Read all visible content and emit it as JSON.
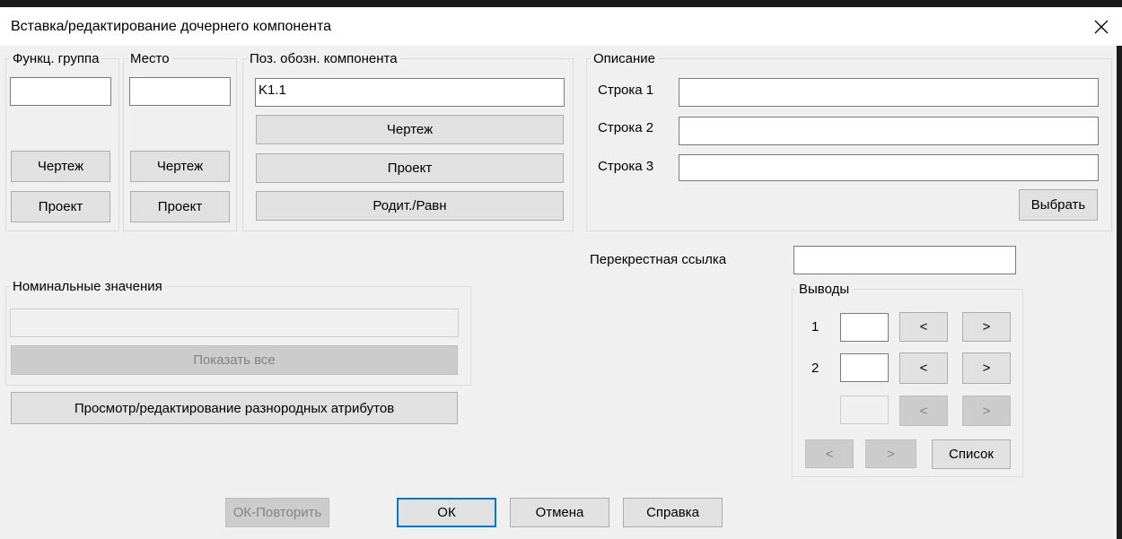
{
  "window": {
    "title": "Вставка/редактирование дочернего компонента"
  },
  "func_group": {
    "legend": "Функц. группа",
    "value": "",
    "drawing_button": "Чертеж",
    "project_button": "Проект"
  },
  "place": {
    "legend": "Место",
    "value": "",
    "drawing_button": "Чертеж",
    "project_button": "Проект"
  },
  "component": {
    "legend": "Поз. обозн. компонента",
    "value": "K1.1",
    "drawing_button": "Чертеж",
    "project_button": "Проект",
    "parent_button": "Родит./Равн"
  },
  "description": {
    "legend": "Описание",
    "lines": [
      {
        "label": "Строка 1",
        "value": ""
      },
      {
        "label": "Строка 2",
        "value": ""
      },
      {
        "label": "Строка 3",
        "value": ""
      }
    ],
    "select_button": "Выбрать"
  },
  "nominal": {
    "legend": "Номинальные значения",
    "value": "",
    "show_all_button": "Показать все"
  },
  "attributes_button": "Просмотр/редактирование разнородных атрибутов",
  "cross_ref": {
    "label": "Перекрестная ссылка",
    "value": ""
  },
  "pins": {
    "legend": "Выводы",
    "rows": [
      {
        "label": "1",
        "value": ""
      },
      {
        "label": "2",
        "value": ""
      },
      {
        "label": "",
        "value": ""
      }
    ],
    "prev": "<",
    "next": ">",
    "list_button": "Список"
  },
  "footer": {
    "ok_repeat": "ОК-Повторить",
    "ok": "ОК",
    "cancel": "Отмена",
    "help": "Справка"
  }
}
